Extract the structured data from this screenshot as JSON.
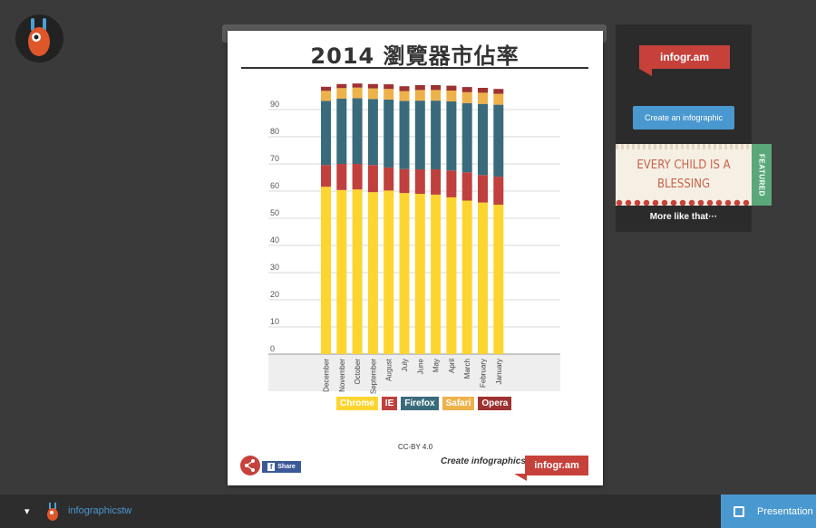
{
  "title": "2014 瀏覽器市佔率",
  "license": "CC-BY 4.0",
  "create_text": "Create infographics",
  "brand": "infogr.am",
  "share_fb": "Share",
  "side": {
    "brand": "infogr.am",
    "create_button": "Create an infographic",
    "featured_text": "EVERY CHILD IS A BLESSING",
    "featured_tag": "FEATURED",
    "more_like": "More like that···"
  },
  "bottom": {
    "username": "infographicstw",
    "presentation": "Presentation"
  },
  "colors": {
    "chrome": "#fdd530",
    "ie": "#c0403e",
    "firefox": "#3a6b7c",
    "safari": "#eeb24a",
    "opera": "#9e3232"
  },
  "chart_data": {
    "type": "bar",
    "stacked": true,
    "categories": [
      "December",
      "November",
      "October",
      "September",
      "August",
      "July",
      "June",
      "May",
      "April",
      "March",
      "February",
      "January"
    ],
    "yticks": [
      0,
      10,
      20,
      30,
      40,
      50,
      60,
      70,
      80,
      90
    ],
    "ylim": [
      0,
      100
    ],
    "series": [
      {
        "name": "Chrome",
        "color": "#fdd530",
        "values": [
          61.6,
          60.4,
          60.6,
          59.6,
          60.2,
          59.3,
          59.0,
          58.7,
          57.7,
          56.5,
          55.8,
          55.0
        ]
      },
      {
        "name": "IE",
        "color": "#c0403e",
        "values": [
          8.0,
          9.6,
          9.4,
          10.0,
          8.5,
          8.8,
          9.0,
          9.3,
          9.9,
          10.4,
          10.1,
          10.3
        ]
      },
      {
        "name": "Firefox",
        "color": "#3a6b7c",
        "values": [
          23.6,
          24.0,
          24.2,
          24.3,
          25.0,
          25.1,
          25.3,
          25.3,
          25.4,
          25.5,
          26.2,
          26.5
        ]
      },
      {
        "name": "Safari",
        "color": "#eeb24a",
        "values": [
          3.7,
          3.9,
          3.9,
          3.9,
          3.9,
          3.6,
          3.9,
          3.9,
          4.0,
          4.0,
          4.1,
          4.0
        ]
      },
      {
        "name": "Opera",
        "color": "#9e3232",
        "values": [
          1.5,
          1.5,
          1.5,
          1.6,
          1.7,
          1.8,
          1.8,
          1.8,
          1.8,
          1.9,
          1.8,
          1.8
        ]
      }
    ],
    "legend": [
      "Chrome",
      "IE",
      "Firefox",
      "Safari",
      "Opera"
    ],
    "legend_position": "bottom"
  }
}
